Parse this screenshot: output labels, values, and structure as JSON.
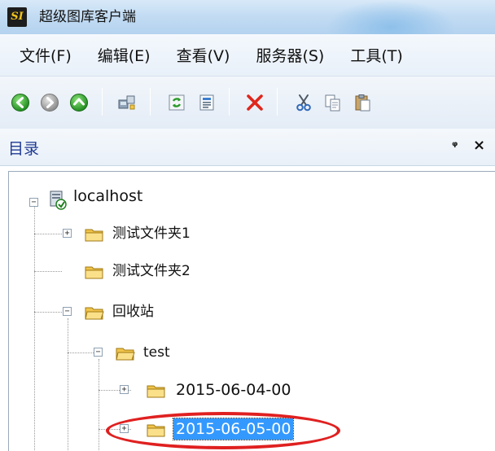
{
  "window": {
    "logo_text": "SI",
    "title": "超级图库客户端"
  },
  "menu": {
    "items": [
      "文件(F)",
      "编辑(E)",
      "查看(V)",
      "服务器(S)",
      "工具(T)"
    ]
  },
  "toolbar": {
    "buttons": [
      "back-icon",
      "forward-icon",
      "up-icon",
      "connect-icon",
      "refresh-icon",
      "properties-icon",
      "delete-icon",
      "cut-icon",
      "copy-icon",
      "paste-icon"
    ]
  },
  "panel": {
    "title": "目录",
    "pin_glyph": "ᵠ",
    "close_glyph": "×"
  },
  "tree": {
    "root": "localhost",
    "folder1": "测试文件夹1",
    "folder2": "测试文件夹2",
    "recycle": "回收站",
    "test": "test",
    "date1": "2015-06-04-00",
    "date2_selected": "2015-06-05-00",
    "expanded_glyph": "−",
    "collapsed_glyph": "+"
  },
  "colors": {
    "selection": "#3399ff",
    "annotation_ring": "#e02020",
    "panel_title": "#1f3a93"
  }
}
